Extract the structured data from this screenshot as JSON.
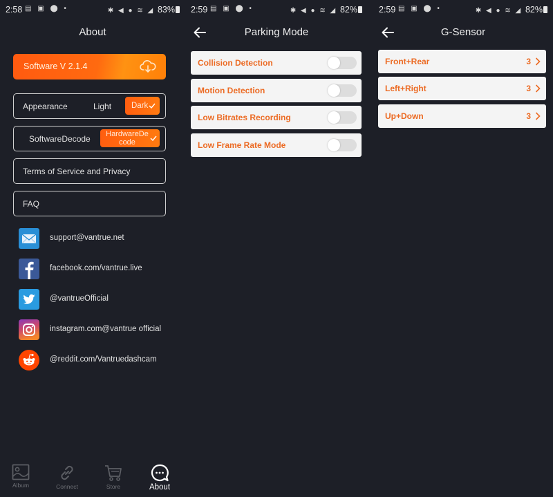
{
  "screens": [
    {
      "status": {
        "time": "2:58",
        "battery": "83%"
      },
      "title": "About",
      "software_button": {
        "label": "Software  V 2.1.4",
        "icon": "cloud-download-icon"
      },
      "appearance": {
        "label": "Appearance",
        "options": [
          "Light",
          "Dark"
        ],
        "selected": "Dark"
      },
      "decode": {
        "options": [
          "SoftwareDecode",
          "HardwareDecode"
        ],
        "selected": "HardwareDecode",
        "selected_line1": "HardwareDe",
        "selected_line2": "code"
      },
      "links": [
        "Terms of Service and Privacy",
        "FAQ"
      ],
      "contacts": [
        {
          "icon": "email-icon",
          "text": "support@vantrue.net"
        },
        {
          "icon": "facebook-icon",
          "text": "facebook.com/vantrue.live"
        },
        {
          "icon": "twitter-icon",
          "text": "@vantrueOfficial"
        },
        {
          "icon": "instagram-icon",
          "text": "instagram.com@vantrue official"
        },
        {
          "icon": "reddit-icon",
          "text": "@reddit.com/Vantruedashcam"
        }
      ],
      "tabs": [
        {
          "label": "Album",
          "icon": "image-icon",
          "active": false
        },
        {
          "label": "Connect",
          "icon": "link-icon",
          "active": false
        },
        {
          "label": "Store",
          "icon": "cart-icon",
          "active": false
        },
        {
          "label": "About",
          "icon": "chat-bubble-icon",
          "active": true
        }
      ]
    },
    {
      "status": {
        "time": "2:59",
        "battery": "82%"
      },
      "title": "Parking Mode",
      "settings": [
        {
          "label": "Collision Detection",
          "enabled": false
        },
        {
          "label": "Motion Detection",
          "enabled": false
        },
        {
          "label": "Low Bitrates Recording",
          "enabled": false
        },
        {
          "label": "Low Frame Rate Mode",
          "enabled": false
        }
      ]
    },
    {
      "status": {
        "time": "2:59",
        "battery": "82%"
      },
      "title": "G-Sensor",
      "axes": [
        {
          "label": "Front+Rear",
          "value": "3"
        },
        {
          "label": "Left+Right",
          "value": "3"
        },
        {
          "label": "Up+Down",
          "value": "3"
        }
      ]
    }
  ],
  "colors": {
    "accent": "#ec6b24",
    "background": "#1d1f27",
    "card": "#f4f4f4"
  }
}
